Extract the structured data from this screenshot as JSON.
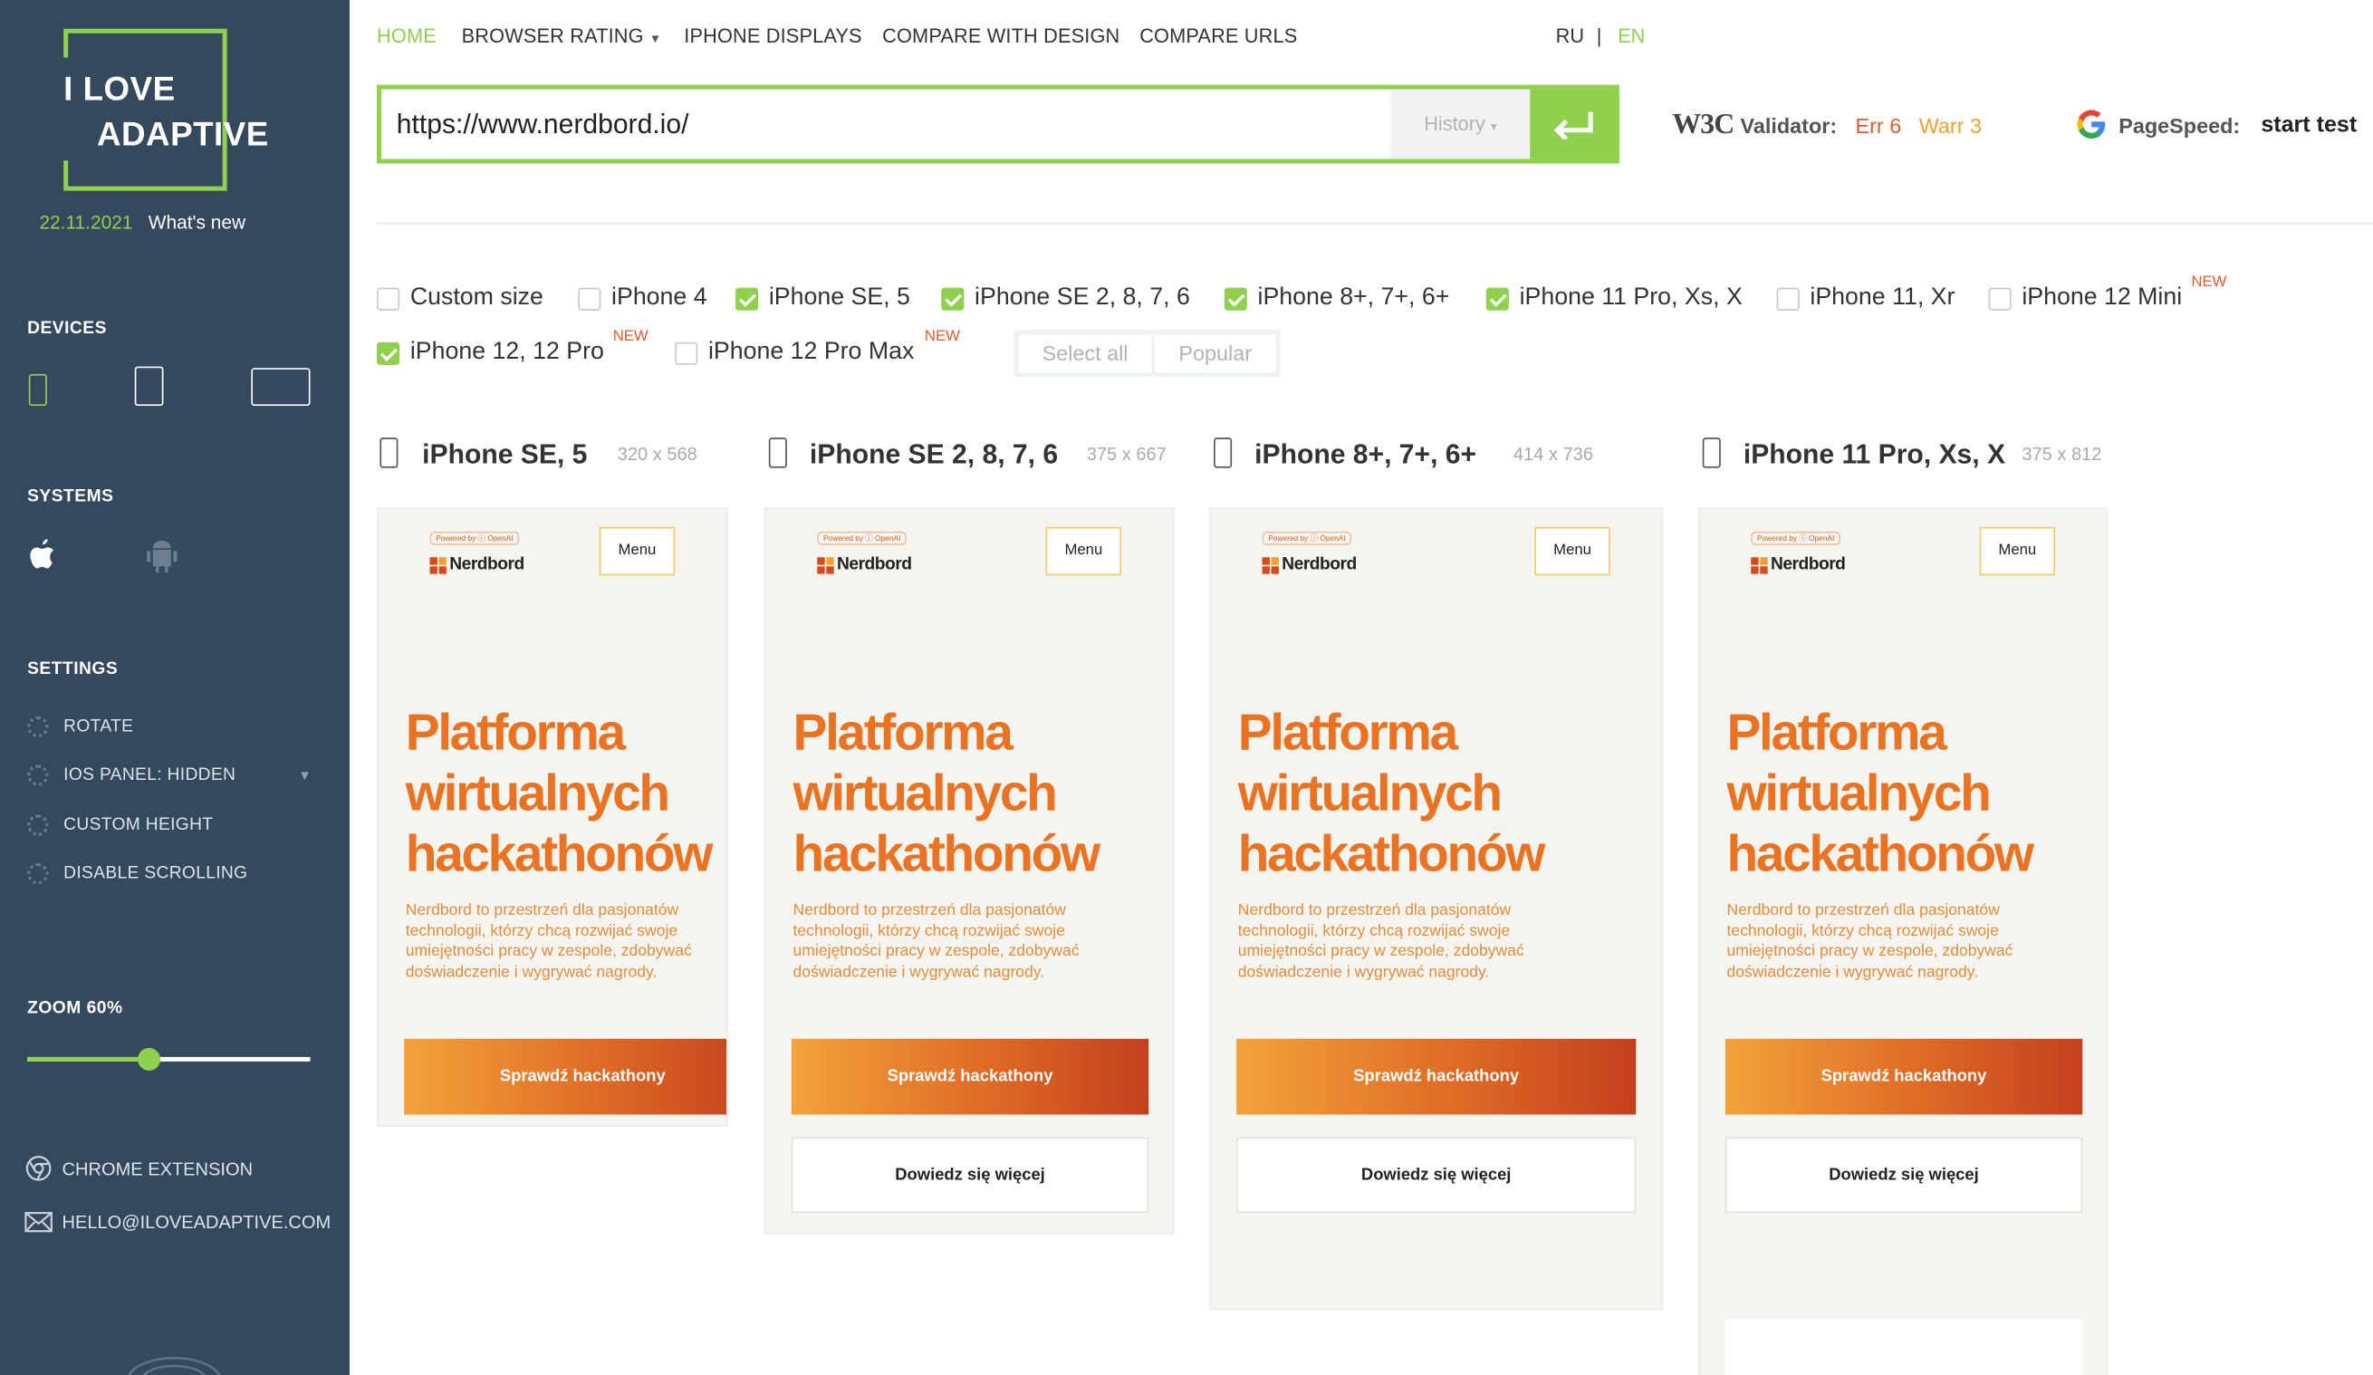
{
  "brand": {
    "logo_line1": "I LOVE",
    "logo_line2": "ADAPTIVE",
    "date": "22.11.2021",
    "whats_new": "What's new"
  },
  "sidebar": {
    "devices_title": "DEVICES",
    "systems_title": "SYSTEMS",
    "settings_title": "SETTINGS",
    "settings": [
      "ROTATE",
      "IOS PANEL:  HIDDEN",
      "CUSTOM HEIGHT",
      "DISABLE SCROLLING"
    ],
    "zoom_label": "ZOOM",
    "zoom_value": "60%",
    "zoom_fraction": 0.43,
    "chrome_extension": "CHROME EXTENSION",
    "email": "HELLO@ILOVEADAPTIVE.COM"
  },
  "nav": {
    "home": "HOME",
    "browser_rating": "BROWSER RATING",
    "iphone_displays": "IPHONE DISPLAYS",
    "compare_design": "COMPARE WITH DESIGN",
    "compare_urls": "COMPARE URLS",
    "lang_ru": "RU",
    "lang_sep": "|",
    "lang_en": "EN"
  },
  "url": {
    "value": "https://www.nerdbord.io/",
    "history_label": "History"
  },
  "validator": {
    "w3c": "W3C",
    "label": "Validator:",
    "err": "Err 6",
    "warr": "Warr 3"
  },
  "pagespeed": {
    "label": "PageSpeed:",
    "action": "start test"
  },
  "device_checkboxes": [
    {
      "label": "Custom size",
      "checked": false
    },
    {
      "label": "iPhone 4",
      "checked": false
    },
    {
      "label": "iPhone SE, 5",
      "checked": true
    },
    {
      "label": "iPhone SE 2, 8, 7, 6",
      "checked": true
    },
    {
      "label": "iPhone 8+, 7+, 6+",
      "checked": true
    },
    {
      "label": "iPhone 11 Pro, Xs, X",
      "checked": true
    },
    {
      "label": "iPhone 11, Xr",
      "checked": false
    },
    {
      "label": "iPhone 12 Mini",
      "checked": false,
      "badge": "NEW"
    },
    {
      "label": "iPhone 12, 12 Pro",
      "checked": true,
      "badge": "NEW"
    },
    {
      "label": "iPhone 12 Pro Max",
      "checked": false,
      "badge": "NEW"
    }
  ],
  "select_all": "Select all",
  "popular": "Popular",
  "previews": [
    {
      "title": "iPhone SE, 5",
      "size": "320 x 568"
    },
    {
      "title": "iPhone SE 2, 8, 7, 6",
      "size": "375 x 667"
    },
    {
      "title": "iPhone 8+, 7+, 6+",
      "size": "414 x 736"
    },
    {
      "title": "iPhone 11 Pro, Xs, X",
      "size": "375 x 812"
    }
  ],
  "site": {
    "powered": "Powered by ⓘ OpenAI",
    "brand": "Nerdbord",
    "menu": "Menu",
    "headline": [
      "Platforma",
      "wirtualnych",
      "hackathonów"
    ],
    "paragraph": [
      "Nerdbord to przestrzeń dla pasjonatów",
      "technologii, którzy chcą rozwijać swoje",
      "umiejętności pracy w zespole, zdobywać",
      "doświadczenie i wygrywać nagrody."
    ],
    "cta": "Sprawdź hackathony",
    "secondary": "Dowiedz się więcej"
  },
  "colors": {
    "accent": "#8fd14f",
    "sidebar": "#34495e",
    "orange": "#ea7223",
    "error": "#e25a2c"
  }
}
